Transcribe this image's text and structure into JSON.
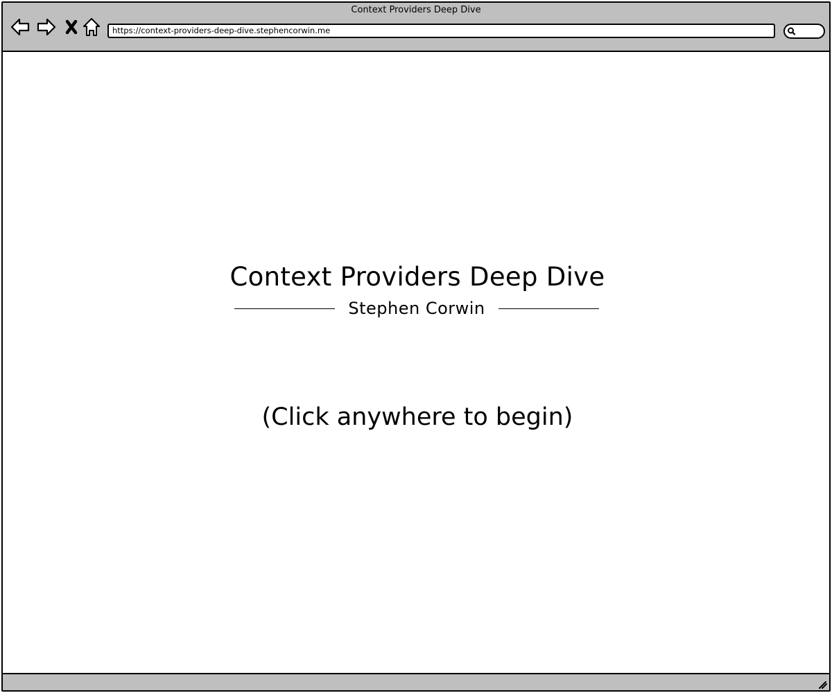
{
  "window": {
    "title": "Context Providers Deep Dive"
  },
  "toolbar": {
    "address": "https://context-providers-deep-dive.stephencorwin.me",
    "icons": {
      "back": "arrow-left-icon",
      "forward": "arrow-right-icon",
      "stop": "close-icon",
      "home": "home-icon",
      "search": "search-icon"
    }
  },
  "slide": {
    "title": "Context Providers Deep Dive",
    "author": "Stephen Corwin",
    "cta": "(Click anywhere to begin)"
  }
}
